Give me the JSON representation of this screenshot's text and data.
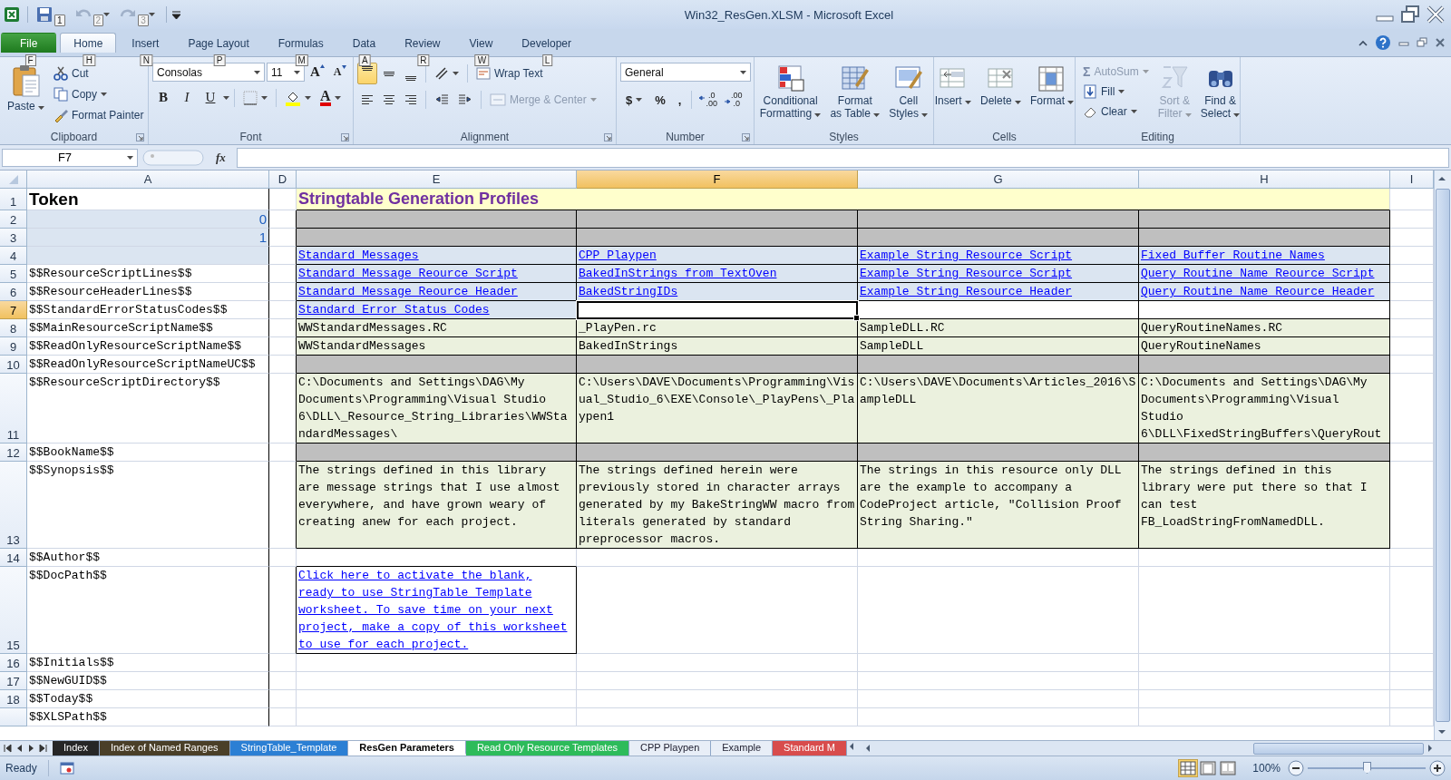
{
  "window": {
    "title": "Win32_ResGen.XLSM - Microsoft Excel"
  },
  "quick_access": [
    {
      "key_tip": "1",
      "disabled": false
    },
    {
      "key_tip": "2",
      "disabled": true
    },
    {
      "key_tip": "3",
      "disabled": true
    }
  ],
  "ribbon": {
    "tabs": [
      {
        "label": "File",
        "key_tip": "F",
        "kind": "file",
        "selected": false
      },
      {
        "label": "Home",
        "key_tip": "H",
        "kind": "tab",
        "selected": true
      },
      {
        "label": "Insert",
        "key_tip": "N",
        "kind": "tab",
        "selected": false
      },
      {
        "label": "Page Layout",
        "key_tip": "P",
        "kind": "tab",
        "selected": false
      },
      {
        "label": "Formulas",
        "key_tip": "M",
        "kind": "tab",
        "selected": false
      },
      {
        "label": "Data",
        "key_tip": "A",
        "kind": "tab",
        "selected": false
      },
      {
        "label": "Review",
        "key_tip": "R",
        "kind": "tab",
        "selected": false
      },
      {
        "label": "View",
        "key_tip": "W",
        "kind": "tab",
        "selected": false
      },
      {
        "label": "Developer",
        "key_tip": "L",
        "kind": "tab",
        "selected": false
      }
    ],
    "groups": [
      {
        "kind": "clipboard",
        "label": "Clipboard",
        "launcher": true,
        "paste": "Paste",
        "commands": [
          {
            "label": "Cut"
          },
          {
            "label": "Copy"
          },
          {
            "label": "Format Painter"
          }
        ]
      },
      {
        "kind": "font",
        "label": "Font",
        "launcher": true,
        "font_name": "Consolas",
        "font_size": "11",
        "grow": "A",
        "shrink": "A",
        "styles": [
          "B",
          "I",
          "U"
        ],
        "font_color": "A"
      },
      {
        "kind": "alignment",
        "label": "Alignment",
        "launcher": true,
        "vertical": [
          {
            "selected": true
          },
          {
            "selected": false
          },
          {
            "selected": false
          }
        ],
        "horizontal": [
          {
            "selected": false
          },
          {
            "selected": false
          },
          {
            "selected": false
          }
        ],
        "wrap_text": {
          "label": "Wrap Text",
          "disabled": false
        },
        "merge": {
          "label": "Merge & Center",
          "disabled": true
        }
      },
      {
        "kind": "number",
        "label": "Number",
        "launcher": true,
        "format": "General",
        "symbols": [
          "$",
          "%",
          ","
        ],
        "decimals": [
          {
            "top": ".0",
            "bottom": ".00"
          },
          {
            "top": ".00",
            "bottom": ".0"
          }
        ]
      },
      {
        "kind": "styles",
        "label": "Styles",
        "launcher": false,
        "commands": [
          {
            "lines": [
              "Conditional",
              "Formatting"
            ]
          },
          {
            "lines": [
              "Format",
              "as Table"
            ]
          },
          {
            "lines": [
              "Cell",
              "Styles"
            ]
          }
        ]
      },
      {
        "kind": "cells",
        "label": "Cells",
        "launcher": false,
        "commands": [
          {
            "lines": [
              "Insert"
            ]
          },
          {
            "lines": [
              "Delete"
            ]
          },
          {
            "lines": [
              "Format"
            ]
          }
        ]
      },
      {
        "kind": "editing",
        "label": "Editing",
        "launcher": false,
        "small": [
          {
            "label": "AutoSum",
            "icon": "Σ",
            "disabled": true
          },
          {
            "label": "Fill",
            "disabled": false
          },
          {
            "label": "Clear",
            "disabled": false
          }
        ],
        "large": [
          {
            "lines": [
              "Sort &",
              "Filter"
            ],
            "disabled": true
          },
          {
            "lines": [
              "Find &",
              "Select"
            ],
            "disabled": false
          }
        ]
      }
    ]
  },
  "formula_bar": {
    "name_box": "F7",
    "function_label": "fx"
  },
  "sheet": {
    "columns": [
      {
        "label": "A",
        "selected": false
      },
      {
        "label": "D",
        "selected": false
      },
      {
        "label": "E",
        "selected": false
      },
      {
        "label": "F",
        "selected": true
      },
      {
        "label": "G",
        "selected": false
      },
      {
        "label": "H",
        "selected": false
      },
      {
        "label": "I",
        "selected": false
      }
    ],
    "rows": [
      {
        "label": "1",
        "selected": false,
        "cells": [
          {
            "text": "Token",
            "kind": "heading",
            "selected": false
          },
          {
            "selected": false
          },
          {
            "text": "Stringtable Generation Profiles",
            "kind": "title",
            "color": "#ffffcc",
            "selected": false
          },
          {
            "selected": false
          }
        ]
      },
      {
        "label": "2",
        "selected": false,
        "cells": [
          {
            "text": "0",
            "kind": "number",
            "color": "#dbe5f1",
            "selected": false
          },
          {
            "selected": false
          },
          {
            "kind": "table_text",
            "color": "#bfbfbf",
            "selected": false
          },
          {
            "kind": "table_text",
            "color": "#bfbfbf",
            "selected": false
          },
          {
            "kind": "table_text",
            "color": "#bfbfbf",
            "selected": false
          },
          {
            "kind": "table_text",
            "color": "#bfbfbf",
            "selected": false
          },
          {
            "selected": false
          }
        ]
      },
      {
        "label": "3",
        "selected": false,
        "cells": [
          {
            "text": "1",
            "kind": "number",
            "color": "#dbe5f1",
            "selected": false
          },
          {
            "selected": false
          },
          {
            "kind": "table_text",
            "color": "#bfbfbf",
            "selected": false
          },
          {
            "kind": "table_text",
            "color": "#bfbfbf",
            "selected": false
          },
          {
            "kind": "table_text",
            "color": "#bfbfbf",
            "selected": false
          },
          {
            "kind": "table_text",
            "color": "#bfbfbf",
            "selected": false
          },
          {
            "selected": false
          }
        ]
      },
      {
        "label": "4",
        "selected": false,
        "cells": [
          {
            "kind": "text",
            "color": "#dbe5f1",
            "selected": false
          },
          {
            "selected": false
          },
          {
            "text": "Standard Messages",
            "kind": "table_link",
            "color": "#dbe5f1",
            "selected": false
          },
          {
            "text": "CPP Playpen",
            "kind": "table_link",
            "color": "#dbe5f1",
            "selected": false
          },
          {
            "text": "Example String Resource Script",
            "kind": "table_link",
            "color": "#dbe5f1",
            "selected": false
          },
          {
            "text": "Fixed Buffer Routine Names",
            "kind": "table_link",
            "color": "#dbe5f1",
            "selected": false
          },
          {
            "selected": false
          }
        ]
      },
      {
        "label": "5",
        "selected": false,
        "cells": [
          {
            "text": "$$ResourceScriptLines$$",
            "kind": "text",
            "selected": false
          },
          {
            "selected": false
          },
          {
            "text": "Standard Message Reource Script",
            "kind": "table_link",
            "color": "#dbe5f1",
            "selected": false
          },
          {
            "text": "BakedInStrings from TextOven",
            "kind": "table_link",
            "color": "#dbe5f1",
            "selected": false
          },
          {
            "text": "Example String Resource Script",
            "kind": "table_link",
            "color": "#dbe5f1",
            "selected": false
          },
          {
            "text": "Query Routine Name Reource Script",
            "kind": "table_link",
            "color": "#dbe5f1",
            "selected": false
          },
          {
            "selected": false
          }
        ]
      },
      {
        "label": "6",
        "selected": false,
        "cells": [
          {
            "text": "$$ResourceHeaderLines$$",
            "kind": "text",
            "selected": false
          },
          {
            "selected": false
          },
          {
            "text": "Standard Message Reource Header",
            "kind": "table_link",
            "color": "#dbe5f1",
            "selected": false
          },
          {
            "text": "BakedStringIDs",
            "kind": "table_link",
            "color": "#dbe5f1",
            "selected": false
          },
          {
            "text": "Example String Resource Header",
            "kind": "table_link",
            "color": "#dbe5f1",
            "selected": false
          },
          {
            "text": "Query Routine Name Reource Header",
            "kind": "table_link",
            "color": "#dbe5f1",
            "selected": false
          },
          {
            "selected": false
          }
        ]
      },
      {
        "label": "7",
        "selected": true,
        "cells": [
          {
            "text": "$$StandardErrorStatusCodes$$",
            "kind": "text",
            "selected": false
          },
          {
            "selected": false
          },
          {
            "text": "Standard Error Status Codes",
            "kind": "table_link",
            "color": "#dbe5f1",
            "selected": false
          },
          {
            "kind": "table_text",
            "selected": true
          },
          {
            "kind": "table_text",
            "selected": false
          },
          {
            "kind": "table_text",
            "selected": false
          },
          {
            "selected": false
          }
        ]
      },
      {
        "label": "8",
        "selected": false,
        "cells": [
          {
            "text": "$$MainResourceScriptName$$",
            "kind": "text",
            "selected": false
          },
          {
            "selected": false
          },
          {
            "text": "WWStandardMessages.RC",
            "kind": "table_text",
            "color": "#ebf1de",
            "selected": false
          },
          {
            "text": "_PlayPen.rc",
            "kind": "table_text",
            "color": "#ebf1de",
            "selected": false
          },
          {
            "text": "SampleDLL.RC",
            "kind": "table_text",
            "color": "#ebf1de",
            "selected": false
          },
          {
            "text": "QueryRoutineNames.RC",
            "kind": "table_text",
            "color": "#ebf1de",
            "selected": false
          },
          {
            "selected": false
          }
        ]
      },
      {
        "label": "9",
        "selected": false,
        "cells": [
          {
            "text": "$$ReadOnlyResourceScriptName$$",
            "kind": "text",
            "selected": false
          },
          {
            "selected": false
          },
          {
            "text": "WWStandardMessages",
            "kind": "table_text",
            "color": "#ebf1de",
            "selected": false
          },
          {
            "text": "BakedInStrings",
            "kind": "table_text",
            "color": "#ebf1de",
            "selected": false
          },
          {
            "text": "SampleDLL",
            "kind": "table_text",
            "color": "#ebf1de",
            "selected": false
          },
          {
            "text": "QueryRoutineNames",
            "kind": "table_text",
            "color": "#ebf1de",
            "selected": false
          },
          {
            "selected": false
          }
        ]
      },
      {
        "label": "10",
        "selected": false,
        "cells": [
          {
            "text": "$$ReadOnlyResourceScriptNameUC$$",
            "kind": "text",
            "selected": false
          },
          {
            "selected": false
          },
          {
            "kind": "table_text",
            "color": "#bfbfbf",
            "selected": false
          },
          {
            "kind": "table_text",
            "color": "#bfbfbf",
            "selected": false
          },
          {
            "kind": "table_text",
            "color": "#bfbfbf",
            "selected": false
          },
          {
            "kind": "table_text",
            "color": "#bfbfbf",
            "selected": false
          },
          {
            "selected": false
          }
        ]
      },
      {
        "label": "11",
        "selected": false,
        "cells": [
          {
            "text": "$$ResourceScriptDirectory$$",
            "kind": "text",
            "selected": false
          },
          {
            "selected": false
          },
          {
            "text": "C:\\Documents and Settings\\DAG\\My Documents\\Programming\\Visual Studio 6\\DLL\\_Resource_String_Libraries\\WWStandardMessages\\",
            "kind": "table_text",
            "color": "#ebf1de",
            "selected": false
          },
          {
            "text": "C:\\Users\\DAVE\\Documents\\Programming\\Visual_Studio_6\\EXE\\Console\\_PlayPens\\_Playpen1",
            "kind": "table_text",
            "color": "#ebf1de",
            "selected": false
          },
          {
            "text": "C:\\Users\\DAVE\\Documents\\Articles_2016\\SampleDLL",
            "kind": "table_text",
            "color": "#ebf1de",
            "selected": false
          },
          {
            "text": "C:\\Documents and Settings\\DAG\\My Documents\\Programming\\Visual Studio 6\\DLL\\FixedStringBuffers\\QueryRout",
            "kind": "table_text",
            "color": "#ebf1de",
            "selected": false
          },
          {
            "selected": false
          }
        ]
      },
      {
        "label": "12",
        "selected": false,
        "cells": [
          {
            "text": "$$BookName$$",
            "kind": "text",
            "selected": false
          },
          {
            "selected": false
          },
          {
            "kind": "table_text",
            "color": "#bfbfbf",
            "selected": false
          },
          {
            "kind": "table_text",
            "color": "#bfbfbf",
            "selected": false
          },
          {
            "kind": "table_text",
            "color": "#bfbfbf",
            "selected": false
          },
          {
            "kind": "table_text",
            "color": "#bfbfbf",
            "selected": false
          },
          {
            "selected": false
          }
        ]
      },
      {
        "label": "13",
        "selected": false,
        "cells": [
          {
            "text": "$$Synopsis$$",
            "kind": "text",
            "selected": false
          },
          {
            "selected": false
          },
          {
            "text": "The strings defined in this library are message strings that I use almost everywhere, and have grown weary of creating anew for each project.",
            "kind": "table_text",
            "color": "#ebf1de",
            "selected": false
          },
          {
            "text": "The strings defined herein were previously stored in character arrays generated by my BakeStringWW macro from literals generated by standard preprocessor macros.",
            "kind": "table_text",
            "color": "#ebf1de",
            "selected": false
          },
          {
            "text": "The strings in this resource only DLL are the example to accompany a CodeProject article, \"Collision Proof String Sharing.\"",
            "kind": "table_text",
            "color": "#ebf1de",
            "selected": false
          },
          {
            "text": "The strings defined in this library were put there so that I can test FB_LoadStringFromNamedDLL.",
            "kind": "table_text",
            "color": "#ebf1de",
            "selected": false
          },
          {
            "selected": false
          }
        ]
      },
      {
        "label": "14",
        "selected": false,
        "cells": [
          {
            "text": "$$Author$$",
            "kind": "text",
            "selected": false
          },
          {
            "selected": false
          },
          {
            "selected": false
          },
          {
            "selected": false
          },
          {
            "selected": false
          },
          {
            "selected": false
          },
          {
            "selected": false
          }
        ]
      },
      {
        "label": "15",
        "selected": false,
        "cells": [
          {
            "text": "$$DocPath$$",
            "kind": "text",
            "selected": false
          },
          {
            "selected": false
          },
          {
            "text": "Click here to activate the blank, ready to use StringTable Template worksheet. To save time on your next project, make a copy of this worksheet to use for each project.",
            "kind": "boxed_link",
            "selected": false
          },
          {
            "selected": false
          },
          {
            "selected": false
          },
          {
            "selected": false
          },
          {
            "selected": false
          }
        ]
      },
      {
        "label": "16",
        "selected": false,
        "cells": [
          {
            "text": "$$Initials$$",
            "kind": "text",
            "selected": false
          },
          {
            "selected": false
          },
          {
            "selected": false
          },
          {
            "selected": false
          },
          {
            "selected": false
          },
          {
            "selected": false
          },
          {
            "selected": false
          }
        ]
      },
      {
        "label": "17",
        "selected": false,
        "cells": [
          {
            "text": "$$NewGUID$$",
            "kind": "text",
            "selected": false
          },
          {
            "selected": false
          },
          {
            "selected": false
          },
          {
            "selected": false
          },
          {
            "selected": false
          },
          {
            "selected": false
          },
          {
            "selected": false
          }
        ]
      },
      {
        "label": "18",
        "selected": false,
        "cells": [
          {
            "text": "$$Today$$",
            "kind": "text",
            "selected": false
          },
          {
            "selected": false
          },
          {
            "selected": false
          },
          {
            "selected": false
          },
          {
            "selected": false
          },
          {
            "selected": false
          },
          {
            "selected": false
          }
        ]
      },
      {
        "selected": false,
        "cells": [
          {
            "text": "$$XLSPath$$",
            "kind": "text",
            "selected": false
          },
          {
            "selected": false
          },
          {
            "selected": false
          },
          {
            "selected": false
          },
          {
            "selected": false
          },
          {
            "selected": false
          },
          {
            "selected": false
          }
        ]
      }
    ]
  },
  "sheet_tabs": [
    {
      "label": "Index",
      "color": "#262626",
      "selected": false
    },
    {
      "label": "Index of Named Ranges",
      "color": "#4a3f28",
      "selected": false
    },
    {
      "label": "StringTable_Template",
      "color": "#2b7fd4",
      "selected": false
    },
    {
      "label": "ResGen Parameters",
      "selected": true
    },
    {
      "label": "Read Only Resource Templates",
      "color": "#2dbb5a",
      "selected": false
    },
    {
      "label": "CPP Playpen",
      "selected": false
    },
    {
      "label": "Example",
      "selected": false
    },
    {
      "label": "Standard M",
      "color": "#d84c4c",
      "selected": false
    }
  ],
  "status_bar": {
    "status": "Ready",
    "views": [
      {
        "selected": true
      },
      {
        "selected": false
      },
      {
        "selected": false
      }
    ],
    "zoom": {
      "label": "100%",
      "level": 0.5
    }
  }
}
